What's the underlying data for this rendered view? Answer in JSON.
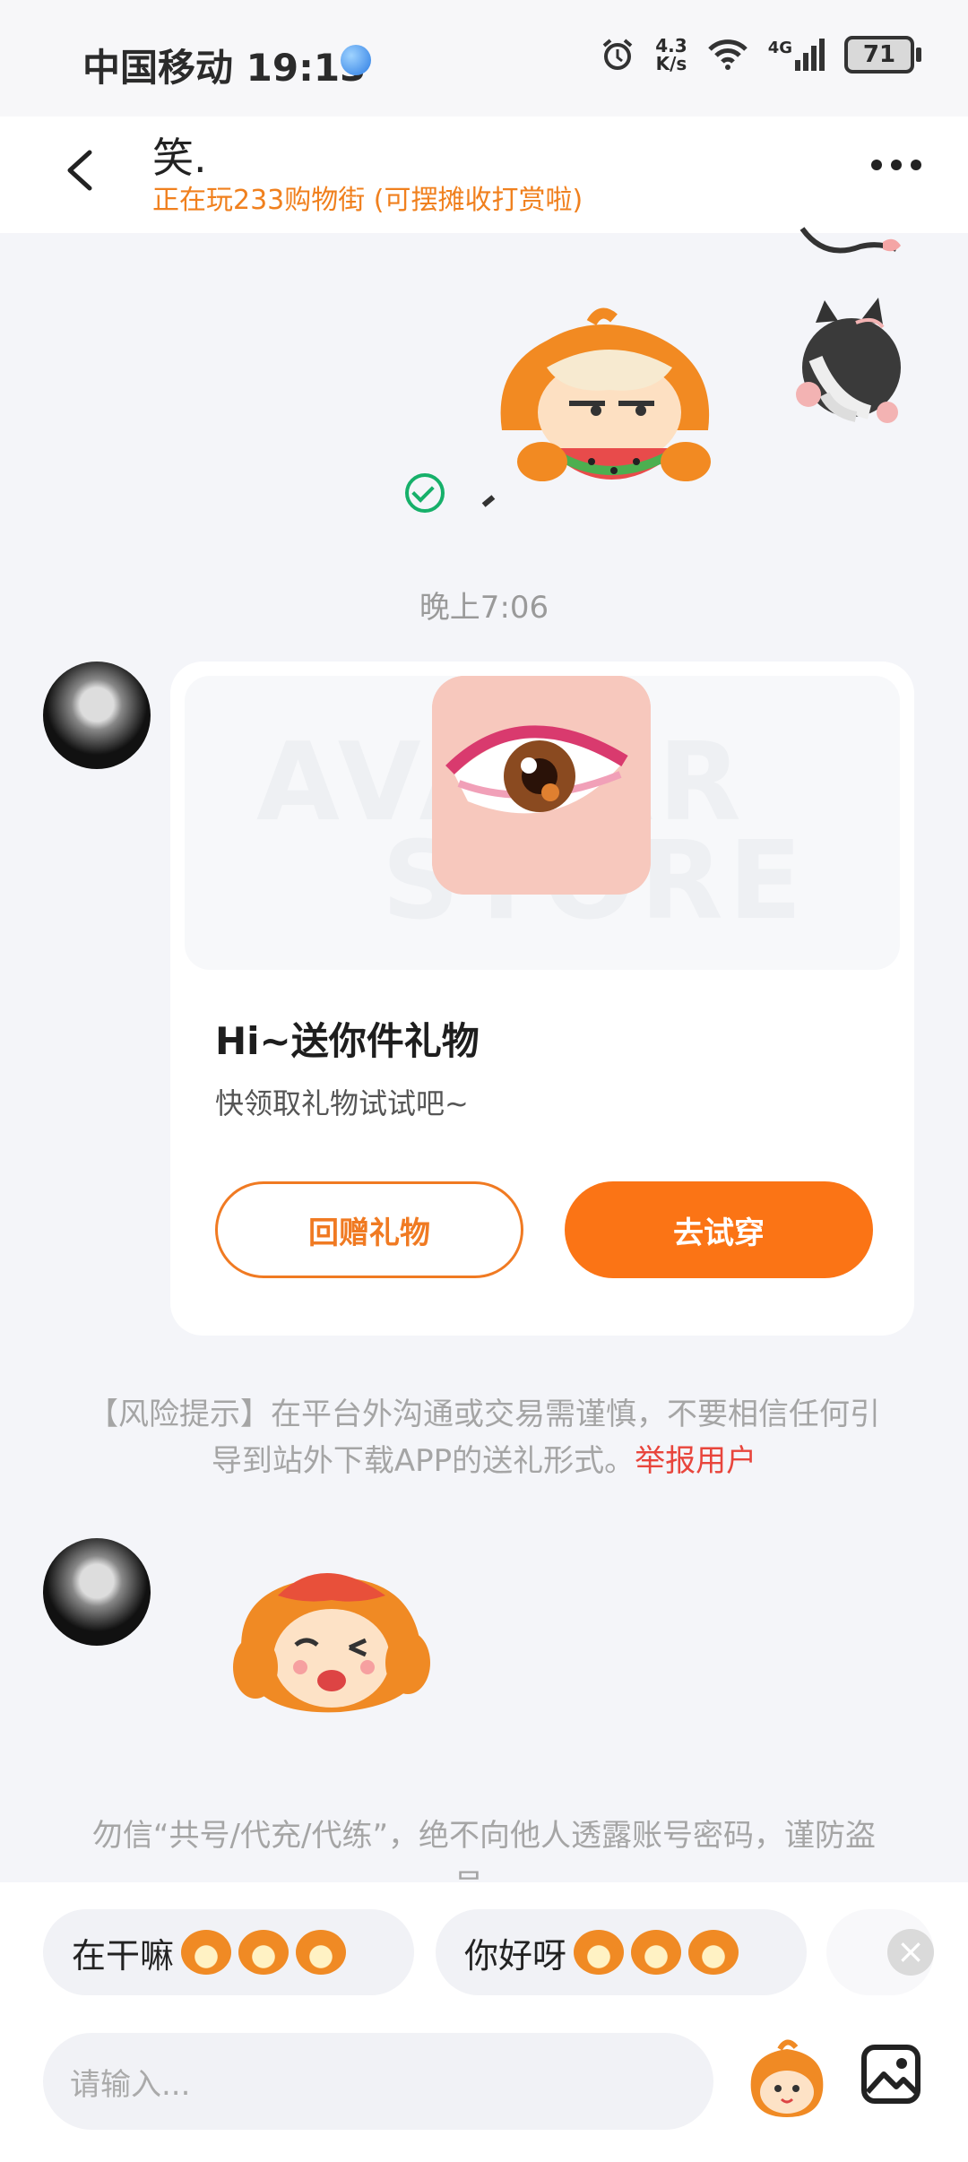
{
  "status_bar": {
    "carrier_time": "中国移动 19:13",
    "speed_top": "4.3",
    "speed_bottom": "K/s",
    "network": "4G",
    "battery": "71"
  },
  "header": {
    "title": "笑.",
    "subtitle": "正在玩233购物街 (可摆摊收打赏啦)"
  },
  "chat": {
    "timestamp": "晚上7:06",
    "gift_card": {
      "watermark_top": "AVATAR",
      "watermark_bottom": "STORE",
      "title": "Hi~送你件礼物",
      "subtitle": "快领取礼物试试吧~",
      "return_gift_label": "回赠礼物",
      "try_on_label": "去试穿"
    },
    "risk_notice": "【风险提示】在平台外沟通或交易需谨慎，不要相信任何引导到站外下载APP的送礼形式。",
    "report_link": "举报用户",
    "security_warning": "勿信“共号/代充/代练”，绝不向他人透露账号密码，谨防盗号。"
  },
  "quick_replies": [
    {
      "text": "在干嘛"
    },
    {
      "text": "你好呀"
    }
  ],
  "input": {
    "placeholder": "请输入..."
  },
  "colors": {
    "accent": "#fb7415",
    "subtitle": "#f0801e",
    "report": "#e8453c",
    "sent_check": "#16b06a"
  }
}
